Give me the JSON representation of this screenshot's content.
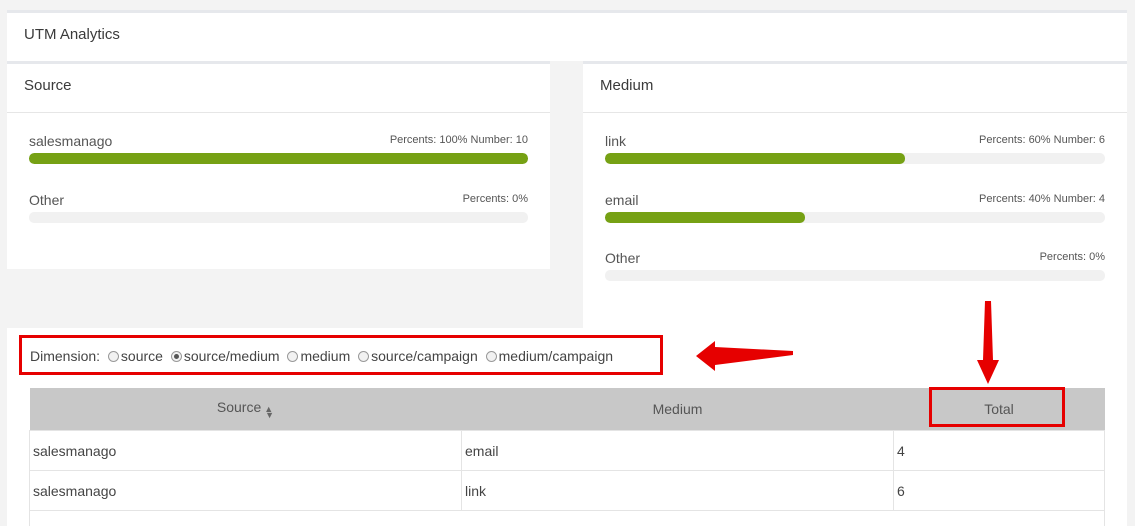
{
  "header": {
    "title": "UTM Analytics"
  },
  "source_panel": {
    "title": "Source",
    "rows": [
      {
        "label": "salesmanago",
        "stats": "Percents: 100% Number: 10",
        "percent": 100
      },
      {
        "label": "Other",
        "stats": "Percents: 0%",
        "percent": 0
      }
    ]
  },
  "medium_panel": {
    "title": "Medium",
    "rows": [
      {
        "label": "link",
        "stats": "Percents: 60% Number: 6",
        "percent": 60
      },
      {
        "label": "email",
        "stats": "Percents: 40% Number: 4",
        "percent": 40
      },
      {
        "label": "Other",
        "stats": "Percents: 0%",
        "percent": 0
      }
    ]
  },
  "dimension": {
    "label": "Dimension:",
    "options": [
      {
        "label": "source",
        "selected": false
      },
      {
        "label": "source/medium",
        "selected": true
      },
      {
        "label": "medium",
        "selected": false
      },
      {
        "label": "source/campaign",
        "selected": false
      },
      {
        "label": "medium/campaign",
        "selected": false
      }
    ]
  },
  "table": {
    "headers": [
      "Source",
      "Medium",
      "Total"
    ],
    "rows": [
      [
        "salesmanago",
        "email",
        "4"
      ],
      [
        "salesmanago",
        "link",
        "6"
      ]
    ]
  },
  "colors": {
    "bar_fill": "#76a114",
    "annotation": "#e60000"
  }
}
